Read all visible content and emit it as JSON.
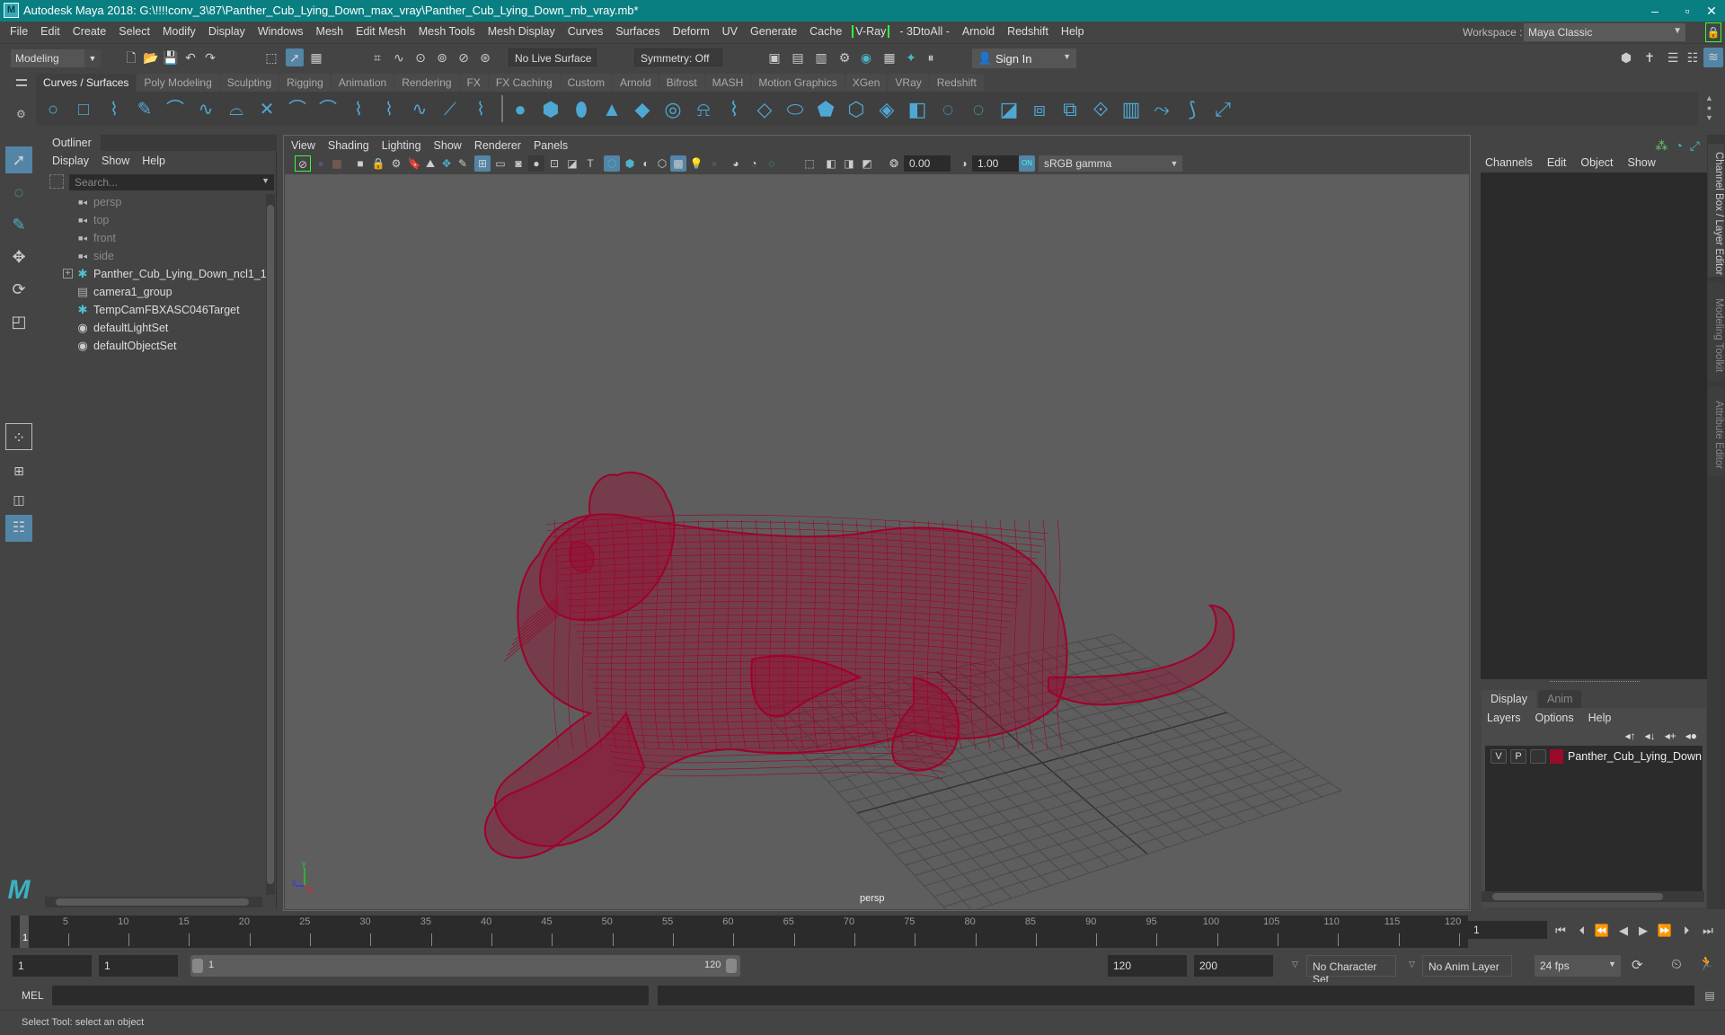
{
  "window": {
    "title": "Autodesk Maya 2018: G:\\!!!!conv_3\\87\\Panther_Cub_Lying_Down_max_vray\\Panther_Cub_Lying_Down_mb_vray.mb*",
    "logo": "M",
    "controls": {
      "minimize": "–",
      "maximize": "▫",
      "close": "✕"
    }
  },
  "menubar": {
    "items": [
      "File",
      "Edit",
      "Create",
      "Select",
      "Modify",
      "Display",
      "Windows",
      "Mesh",
      "Edit Mesh",
      "Mesh Tools",
      "Mesh Display",
      "Curves",
      "Surfaces",
      "Deform",
      "UV",
      "Generate",
      "Cache"
    ],
    "vray": "V-Ray",
    "items2": [
      "- 3DtoAll -",
      "Arnold",
      "Redshift",
      "Help"
    ],
    "workspace_label": "Workspace :",
    "workspace_value": "Maya Classic"
  },
  "statusline": {
    "mode": "Modeling",
    "live_surface": "No Live Surface",
    "symmetry": "Symmetry: Off",
    "sign_in": "Sign In"
  },
  "shelf": {
    "tabs": [
      "Curves / Surfaces",
      "Poly Modeling",
      "Sculpting",
      "Rigging",
      "Animation",
      "Rendering",
      "FX",
      "FX Caching",
      "Custom",
      "Arnold",
      "Bifrost",
      "MASH",
      "Motion Graphics",
      "XGen",
      "VRay",
      "Redshift"
    ],
    "active_tab": "Curves / Surfaces",
    "curve_icons": [
      "nurbs-circle",
      "nurbs-square",
      "cv-curve",
      "pencil-curve",
      "ep-curve",
      "bezier-curve",
      "three-point-arc",
      "intersect-curves",
      "two-point-arc",
      "curve-fillet",
      "curve-offset",
      "attach-curves",
      "detach-curves",
      "rebuild-curve",
      "insert-knot"
    ],
    "surface_icons": [
      "nurbs-sphere",
      "nurbs-cube",
      "nurbs-cylinder",
      "nurbs-cone",
      "nurbs-plane",
      "nurbs-torus",
      "revolve",
      "loft",
      "planar",
      "extrude",
      "birail",
      "bevel-plus",
      "boundary",
      "square-surface",
      "trim-tool",
      "untrim",
      "intersect-surfaces",
      "attach-surfaces",
      "detach-surfaces",
      "sculpt-geometry",
      "rebuild-surface",
      "stitch",
      "surface-fillet",
      "extend-surface"
    ]
  },
  "outliner": {
    "title": "Outliner",
    "menus": [
      "Display",
      "Show",
      "Help"
    ],
    "search_placeholder": "Search...",
    "items": [
      {
        "label": "persp",
        "icon": "camera-icon",
        "dim": true
      },
      {
        "label": "top",
        "icon": "camera-icon",
        "dim": true
      },
      {
        "label": "front",
        "icon": "camera-icon",
        "dim": true
      },
      {
        "label": "side",
        "icon": "camera-icon",
        "dim": true
      },
      {
        "label": "Panther_Cub_Lying_Down_ncl1_1",
        "icon": "transform-icon",
        "expandable": true
      },
      {
        "label": "camera1_group",
        "icon": "group-icon"
      },
      {
        "label": "TempCamFBXASC046Target",
        "icon": "transform-icon"
      },
      {
        "label": "defaultLightSet",
        "icon": "set-icon"
      },
      {
        "label": "defaultObjectSet",
        "icon": "set-icon"
      }
    ]
  },
  "viewport": {
    "menus": [
      "View",
      "Shading",
      "Lighting",
      "Show",
      "Renderer",
      "Panels"
    ],
    "exposure": "0.00",
    "gamma": "1.00",
    "color_space": "sRGB gamma",
    "color_mgmt": "ON",
    "camera": "persp",
    "axes": {
      "x": "x",
      "y": "y",
      "z": "z"
    },
    "wire_color": "#a0002a"
  },
  "channelbox": {
    "menus": [
      "Channels",
      "Edit",
      "Object",
      "Show"
    ],
    "layer_tabs": [
      "Display",
      "Anim"
    ],
    "active_layer_tab": "Display",
    "layer_menus": [
      "Layers",
      "Options",
      "Help"
    ],
    "layers": [
      {
        "v": "V",
        "p": "P",
        "color": "#9a0a2a",
        "name": "Panther_Cub_Lying_Down"
      }
    ]
  },
  "sidetabs": [
    "Channel Box / Layer Editor",
    "Modeling Toolkit",
    "Attribute Editor"
  ],
  "timeline": {
    "start": 1,
    "end": 120,
    "major_step": 5,
    "current_frame": "1",
    "playback_controls": [
      "go-to-start",
      "step-back-key",
      "step-back-frame",
      "play-backwards",
      "play-forwards",
      "step-forward-frame",
      "step-forward-key",
      "go-to-end"
    ]
  },
  "range": {
    "start_time": "1",
    "playback_start": "1",
    "slider_start": "1",
    "slider_end": "120",
    "playback_end": "120",
    "end_time": "200",
    "character_set": "No Character Set",
    "anim_layer": "No Anim Layer",
    "fps": "24 fps"
  },
  "commandline": {
    "label": "MEL"
  },
  "helpline": {
    "text": "Select Tool: select an object"
  }
}
